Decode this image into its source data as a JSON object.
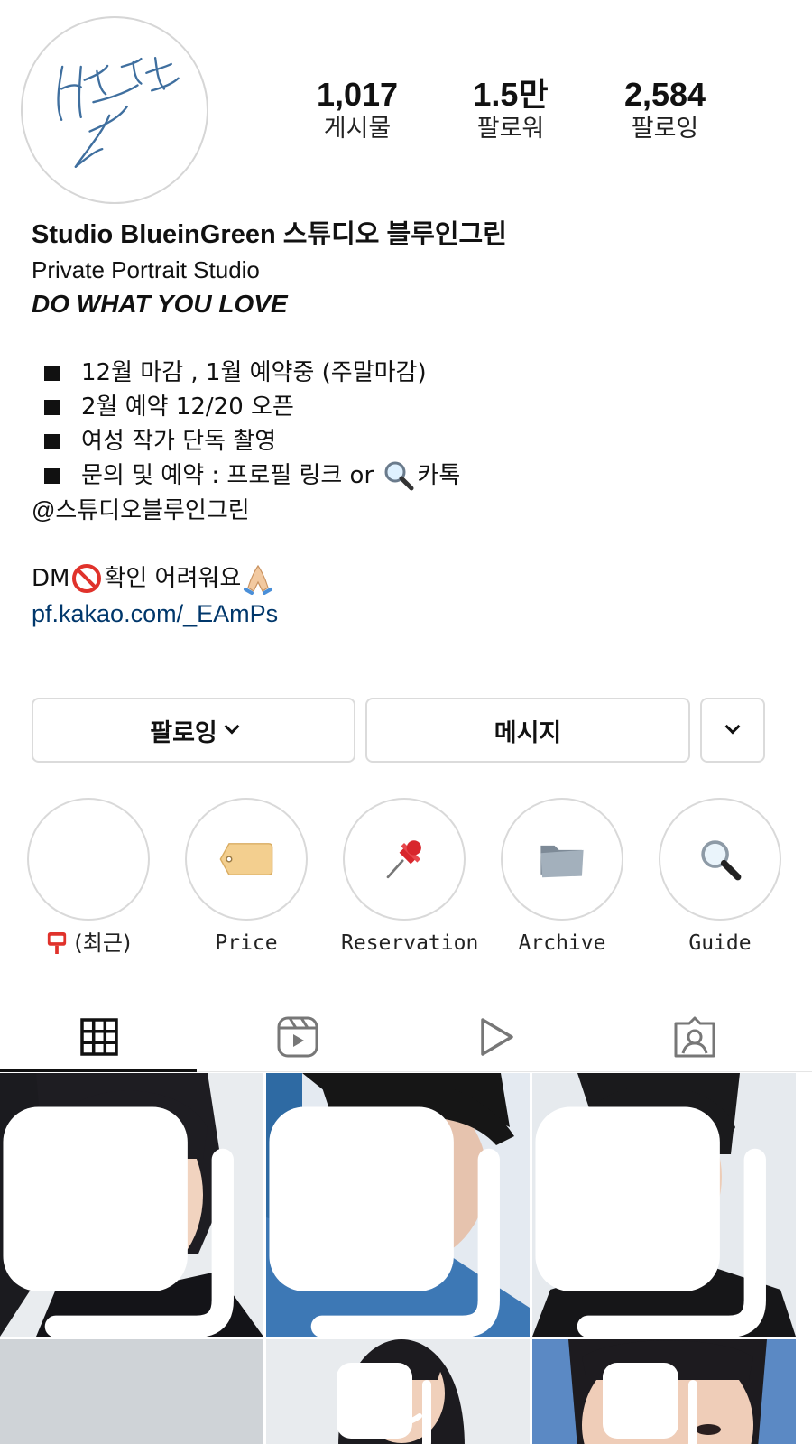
{
  "profile": {
    "stats": [
      {
        "count": "1,017",
        "label": "게시물"
      },
      {
        "count": "1.5만",
        "label": "팔로워"
      },
      {
        "count": "2,584",
        "label": "팔로잉"
      }
    ]
  },
  "bio": {
    "name": "Studio BlueinGreen 스튜디오 블루인그린",
    "category": "Private Portrait Studio",
    "tagline": "DO WHAT YOU LOVE",
    "bullets": [
      "12월 마감 , 1월 예약중 (주말마감)",
      "2월 예약 12/20 오픈",
      "여성 작가 단독 촬영",
      "문의 및 예약 : 프로필 링크 or "
    ],
    "bullet4_suffix": "카톡",
    "handle": "@스튜디오블루인그린",
    "dm_before": "DM",
    "dm_after": "확인 어려워요",
    "link": "pf.kakao.com/_EAmPs"
  },
  "actions": {
    "follow_label": "팔로잉",
    "message_label": "메시지"
  },
  "highlights": [
    {
      "label": "(최근)",
      "icon": "mailbox-icon"
    },
    {
      "label": "Price",
      "icon": "price-tag-icon"
    },
    {
      "label": "Reservation",
      "icon": "pushpin-icon"
    },
    {
      "label": "Archive",
      "icon": "folder-icon"
    },
    {
      "label": "Guide",
      "icon": "magnifier-icon"
    }
  ],
  "tabs": [
    {
      "icon": "grid-icon",
      "active": true
    },
    {
      "icon": "reels-icon",
      "active": false
    },
    {
      "icon": "video-play-icon",
      "active": false
    },
    {
      "icon": "tagged-icon",
      "active": false
    }
  ],
  "colors": {
    "link": "#00376b",
    "border": "#dbdbdb",
    "text": "#111111"
  }
}
